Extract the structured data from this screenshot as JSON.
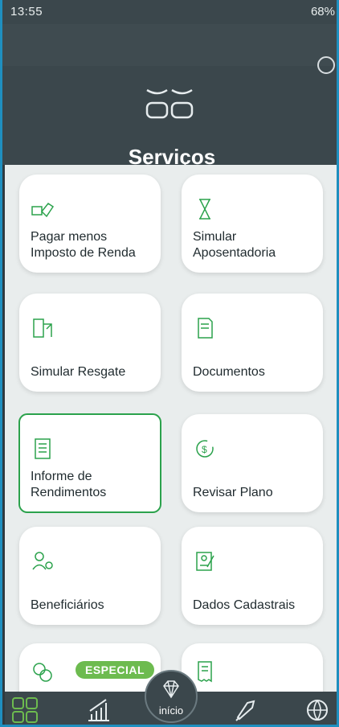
{
  "status_bar": {
    "time": "13:55",
    "battery": "68%"
  },
  "header": {
    "title": "Serviços"
  },
  "cards": [
    {
      "label": "Pagar menos Imposto de Renda",
      "icon": "money-hand-icon"
    },
    {
      "label": "Simular Aposentadoria",
      "icon": "hourglass-icon"
    },
    {
      "label": "Simular Resgate",
      "icon": "withdraw-icon"
    },
    {
      "label": "Documentos",
      "icon": "document-icon"
    },
    {
      "label": "Informe de Rendimentos",
      "icon": "income-report-icon"
    },
    {
      "label": "Revisar Plano",
      "icon": "review-cycle-icon"
    },
    {
      "label": "Beneficiários",
      "icon": "beneficiaries-icon"
    },
    {
      "label": "Dados Cadastrais",
      "icon": "profile-data-icon"
    },
    {
      "label": "",
      "icon": "coins-icon",
      "badge": "ESPECIAL"
    },
    {
      "label": "",
      "icon": "receipt-icon"
    }
  ],
  "nav": {
    "center_label": "início"
  },
  "colors": {
    "header_bg": "#3b474c",
    "accent": "#2ba24c",
    "badge": "#6dbb4f",
    "content_bg": "#e9eded"
  }
}
